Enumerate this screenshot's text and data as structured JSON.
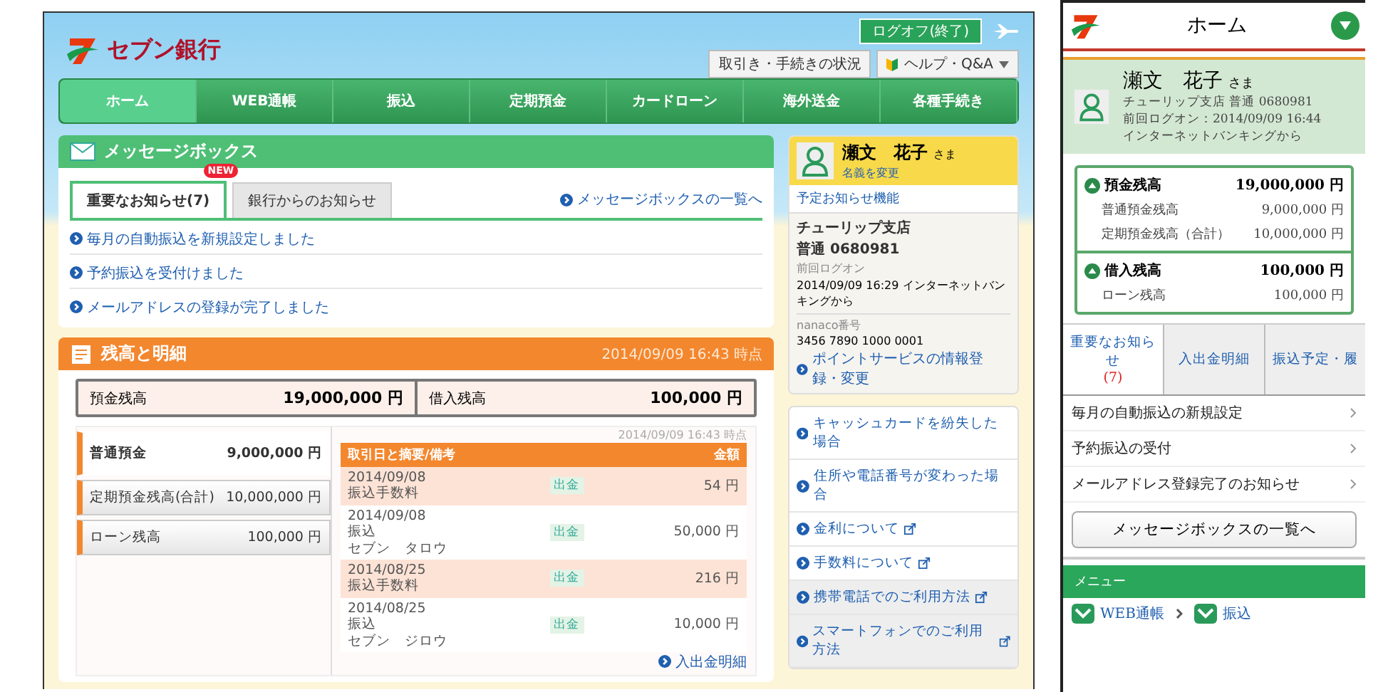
{
  "desktop": {
    "logo": "セブン銀行",
    "logoff_button": "ログオフ(終了)",
    "status_button": "取引き・手続きの状況",
    "help_menu": "ヘルプ・Q&A",
    "nav": [
      {
        "label": "ホーム",
        "selected": true
      },
      {
        "label": "WEB通帳",
        "selected": false
      },
      {
        "label": "振込",
        "selected": false
      },
      {
        "label": "定期預金",
        "selected": false
      },
      {
        "label": "カードローン",
        "selected": false
      },
      {
        "label": "海外送金",
        "selected": false
      },
      {
        "label": "各種手続き",
        "selected": false
      }
    ],
    "message_box": {
      "title": "メッセージボックス",
      "tabs": [
        {
          "label": "重要なお知らせ(7)",
          "selected": true,
          "badge": "NEW"
        },
        {
          "label": "銀行からのお知らせ",
          "selected": false
        }
      ],
      "list_link": "メッセージボックスの一覧へ",
      "items": [
        "毎月の自動振込を新規設定しました",
        "予約振込を受付けました",
        "メールアドレスの登録が完了しました"
      ]
    },
    "balance": {
      "title": "残高と明細",
      "timestamp": "2014/09/09 16:43 時点",
      "summary": [
        {
          "label": "預金残高",
          "amount": "19,000,000 円"
        },
        {
          "label": "借入残高",
          "amount": "100,000 円"
        }
      ],
      "accounts": [
        {
          "label": "普通預金",
          "amount": "9,000,000 円",
          "selected": true
        },
        {
          "label": "定期預金残高(合計)",
          "amount": "10,000,000 円",
          "selected": false
        },
        {
          "label": "ローン残高",
          "amount": "100,000 円",
          "selected": false
        }
      ],
      "detail_timestamp": "2014/09/09 16:43 時点",
      "table": {
        "columns": [
          "取引日と摘要/備考",
          "金額"
        ],
        "rows": [
          {
            "date": "2014/09/08",
            "lines": [
              "振込手数料"
            ],
            "type": "出金",
            "amount": "54 円"
          },
          {
            "date": "2014/09/08",
            "lines": [
              "振込",
              "セブン　タロウ"
            ],
            "type": "出金",
            "amount": "50,000 円"
          },
          {
            "date": "2014/08/25",
            "lines": [
              "振込手数料"
            ],
            "type": "出金",
            "amount": "216 円"
          },
          {
            "date": "2014/08/25",
            "lines": [
              "振込",
              "セブン　ジロウ"
            ],
            "type": "出金",
            "amount": "10,000 円"
          }
        ]
      },
      "detail_link": "入出金明細"
    },
    "sidebar": {
      "user_name": "瀬文　花子",
      "honorific": "さま",
      "change_link": "名義を変更",
      "notice_tab": "予定お知らせ機能",
      "branch": "チューリップ支店",
      "account": "普通 0680981",
      "last_logon_label": "前回ログオン",
      "last_logon": "2014/09/09 16:29 インターネットバンキングから",
      "nanaco_label": "nanaco番号",
      "nanaco_number": "3456 7890 1000 0001",
      "point_link": "ポイントサービスの情報登録・変更",
      "links": [
        {
          "label": "キャッシュカードを紛失した場合",
          "external": false
        },
        {
          "label": "住所や電話番号が変わった場合",
          "external": false
        },
        {
          "label": "金利について",
          "external": true
        },
        {
          "label": "手数料について",
          "external": true
        }
      ],
      "device_links": [
        {
          "label": "携帯電話でのご利用方法",
          "external": true
        },
        {
          "label": "スマートフォンでのご利用方法",
          "external": true
        }
      ]
    }
  },
  "mobile": {
    "title": "ホーム",
    "user_name": "瀬文　花子",
    "honorific": "さま",
    "account": "チューリップ支店 普通 0680981",
    "last_logon": "前回ログオン：2014/09/09 16:44",
    "logon_channel": "インターネットバンキングから",
    "balance_groups": [
      {
        "label": "預金残高",
        "amount": "19,000,000 円",
        "items": [
          {
            "label": "普通預金残高",
            "amount": "9,000,000 円"
          },
          {
            "label": "定期預金残高（合計）",
            "amount": "10,000,000 円"
          }
        ]
      },
      {
        "label": "借入残高",
        "amount": "100,000 円",
        "items": [
          {
            "label": "ローン残高",
            "amount": "100,000 円"
          }
        ]
      }
    ],
    "tabs": [
      {
        "label": "重要なお知らせ",
        "count": "(7)",
        "selected": true
      },
      {
        "label": "入出金明細",
        "selected": false
      },
      {
        "label": "振込予定・履",
        "selected": false
      }
    ],
    "notices": [
      "毎月の自動振込の新規設定",
      "予約振込の受付",
      "メールアドレス登録完了のお知らせ"
    ],
    "list_button": "メッセージボックスの一覧へ",
    "menu_title": "メニュー",
    "menu_items": [
      "WEB通帳",
      "振込"
    ]
  }
}
